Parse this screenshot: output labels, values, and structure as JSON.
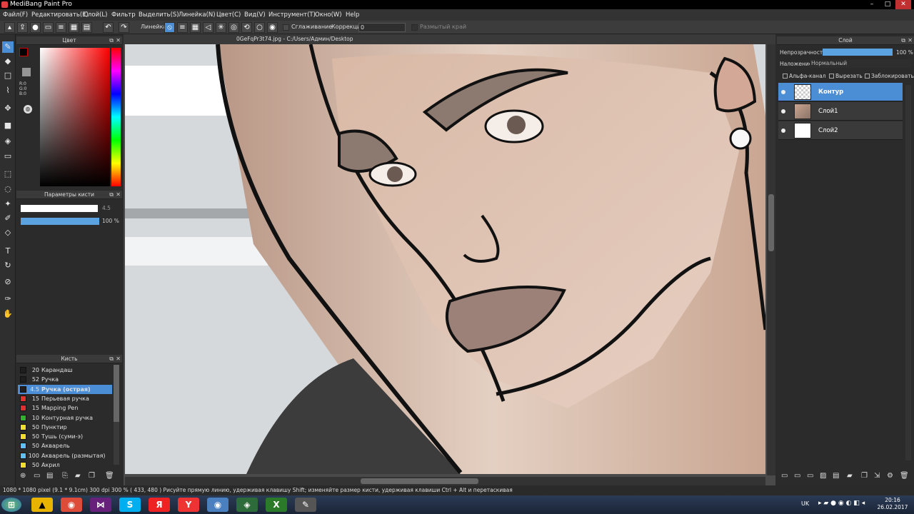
{
  "window": {
    "title": "MediBang Paint Pro"
  },
  "menu": [
    "Файл(F)",
    "Редактировать(E)",
    "Слой(L)",
    "Фильтр",
    "Выделить(S)",
    "Линейка(N)",
    "Цвет(C)",
    "Вид(V)",
    "Инструмент(T)",
    "Окно(W)",
    "Help"
  ],
  "toolbar": {
    "ruler_label": "Линейка",
    "smoothing_label": "Сглаживание",
    "correction_label": "Коррекция",
    "correction_value": "0",
    "blur_edge_label": "Размытый край"
  },
  "color_panel": {
    "title": "Цвет",
    "r": "R:0",
    "g": "G:0",
    "b": "B:0"
  },
  "brush_params": {
    "title": "Параметры кисти",
    "size": "4.5",
    "opacity": "100 %"
  },
  "brush_panel": {
    "title": "Кисть",
    "items": [
      {
        "size": "20",
        "name": "Карандаш",
        "color": "#1e1e1e"
      },
      {
        "size": "52",
        "name": "Ручка",
        "color": "#1e1e1e"
      },
      {
        "size": "4.5",
        "name": "Ручка (острая)",
        "color": "#1e1e1e"
      },
      {
        "size": "15",
        "name": "Перьевая ручка",
        "color": "#e03030"
      },
      {
        "size": "15",
        "name": "Mapping Pen",
        "color": "#e03030"
      },
      {
        "size": "10",
        "name": "Контурная ручка",
        "color": "#30b030"
      },
      {
        "size": "50",
        "name": "Пунктир",
        "color": "#f0e030"
      },
      {
        "size": "50",
        "name": "Тушь (суми-э)",
        "color": "#f0e030"
      },
      {
        "size": "50",
        "name": "Акварель",
        "color": "#60c0f0"
      },
      {
        "size": "100",
        "name": "Акварель (размытая)",
        "color": "#60c0f0"
      },
      {
        "size": "50",
        "name": "Акрил",
        "color": "#f0e030"
      }
    ]
  },
  "document": {
    "tab": "0GeFqPr3t74.jpg - C:/Users/Админ/Desktop"
  },
  "layer_panel": {
    "title": "Слой",
    "opacity_label": "Непрозрачность",
    "opacity_value": "100 %",
    "blend_label": "Наложение",
    "blend_value": "Нормальный",
    "alpha_label": "Альфа-канал",
    "clip_label": "Вырезать",
    "lock_label": "Заблокировать",
    "layers": [
      {
        "name": "Контур"
      },
      {
        "name": "Слой1"
      },
      {
        "name": "Слой2"
      }
    ]
  },
  "status": {
    "text": "1080 * 1080 pixel   (9.1 * 9.1cm)   300 dpi   300 %   ( 433, 480 )   Рисуйте прямую линию, удерживая клавишу Shift; изменяйте размер кисти, удерживая клавиши Ctrl + Alt и перетаскивая"
  },
  "taskbar": {
    "lang": "UK",
    "time": "20:16",
    "date": "26.02.2017"
  }
}
